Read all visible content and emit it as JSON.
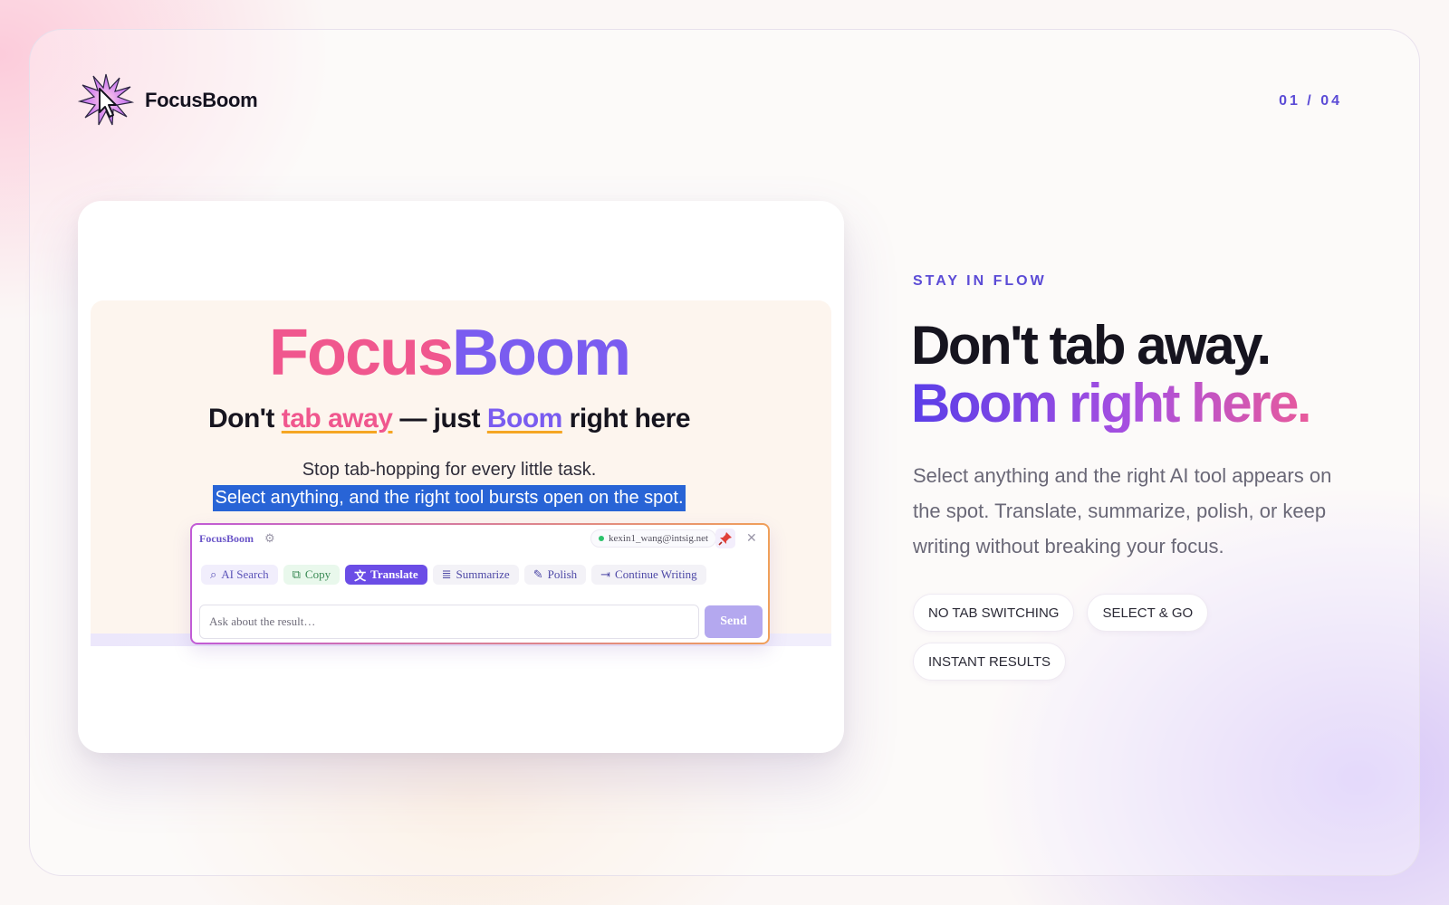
{
  "brand": {
    "name": "FocusBoom",
    "logo_icon": "starburst-cursor-icon"
  },
  "pager": "01 / 04",
  "preview": {
    "hero_part1": "Focus",
    "hero_part2": "Boom",
    "tag_pre": "Don't ",
    "tag_hl1": "tab away",
    "tag_mid": " — just ",
    "tag_hl2": "Boom",
    "tag_post": " right here",
    "sub": "Stop tab-hopping for every little task.",
    "selected": "Select anything, and the right tool bursts open on the spot.",
    "popup": {
      "title": "FocusBoom",
      "user": "kexin1_wang@intsig.net",
      "tools": [
        {
          "label": "AI Search",
          "icon": "search-icon"
        },
        {
          "label": "Copy",
          "icon": "copy-icon"
        },
        {
          "label": "Translate",
          "icon": "translate-icon"
        },
        {
          "label": "Summarize",
          "icon": "summarize-icon"
        },
        {
          "label": "Polish",
          "icon": "pen-icon"
        },
        {
          "label": "Continue Writing",
          "icon": "continue-icon"
        }
      ],
      "input_placeholder": "Ask about the result…",
      "send_label": "Send"
    }
  },
  "main": {
    "eyebrow": "STAY IN FLOW",
    "headline_line1": "Don't tab away.",
    "headline_line2": "Boom right here.",
    "description": "Select anything and the right AI tool appears on the spot. Translate, summarize, polish, or keep writing without breaking your focus.",
    "chips": [
      "NO TAB SWITCHING",
      "SELECT & GO",
      "INSTANT RESULTS"
    ]
  },
  "colors": {
    "accent": "#5b4bd6",
    "pink": "#f0578e",
    "purple": "#7a5cf0",
    "selection": "#2864d6"
  }
}
